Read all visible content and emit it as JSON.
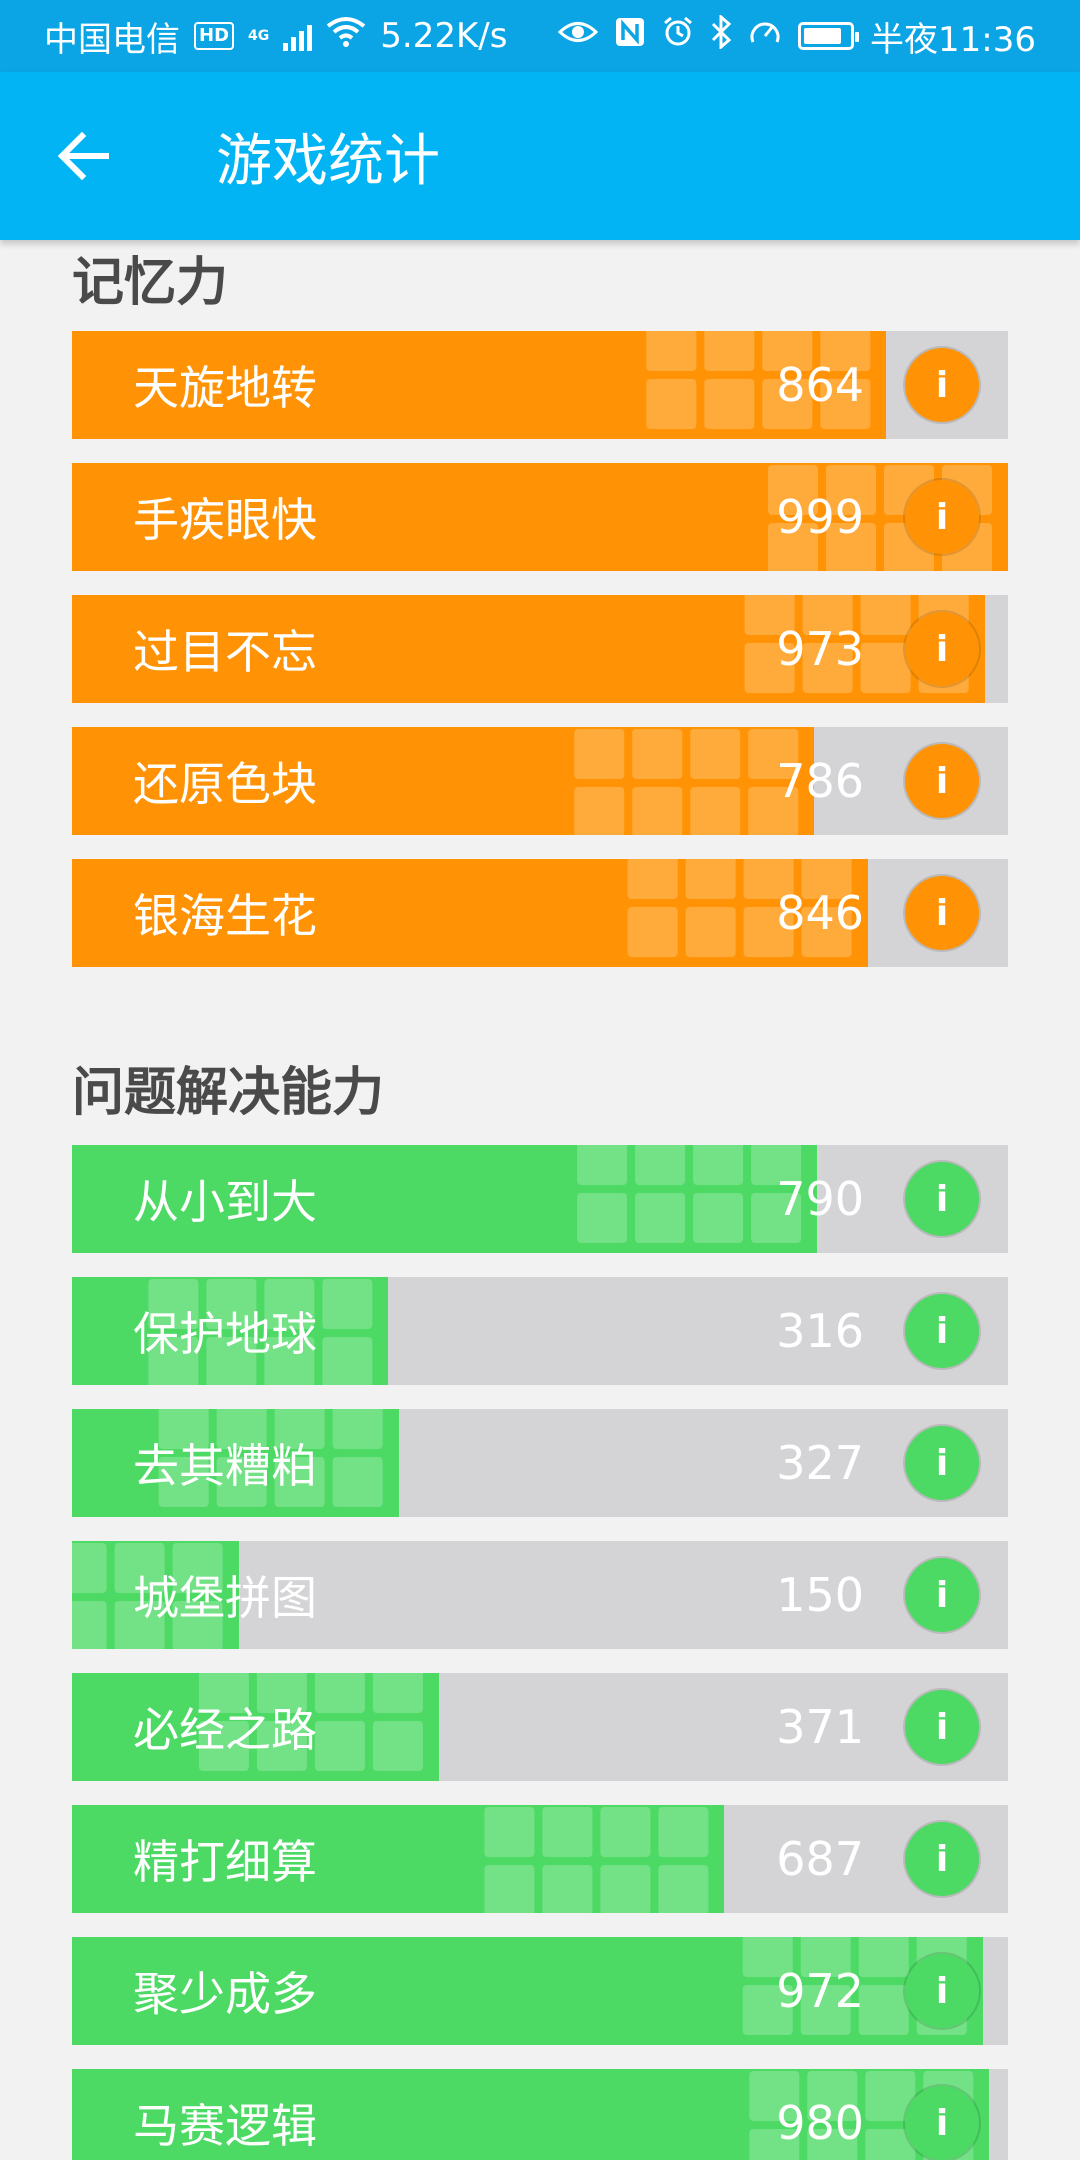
{
  "status_bar": {
    "carrier": "中国电信",
    "hd": "HD",
    "network": "4G",
    "speed": "5.22K/s",
    "time": "半夜11:36",
    "battery_level": 0.85
  },
  "app_bar": {
    "title": "游戏统计"
  },
  "sections": [
    {
      "title": "记忆力",
      "color": "#ff9305",
      "games": [
        {
          "name": "天旋地转",
          "score": "864",
          "fill": 0.87
        },
        {
          "name": "手疾眼快",
          "score": "999",
          "fill": 1.0
        },
        {
          "name": "过目不忘",
          "score": "973",
          "fill": 0.975
        },
        {
          "name": "还原色块",
          "score": "786",
          "fill": 0.793
        },
        {
          "name": "银海生花",
          "score": "846",
          "fill": 0.85
        }
      ]
    },
    {
      "title": "问题解决能力",
      "color": "#4cd964",
      "games": [
        {
          "name": "从小到大",
          "score": "790",
          "fill": 0.796
        },
        {
          "name": "保护地球",
          "score": "316",
          "fill": 0.338
        },
        {
          "name": "去其糟粕",
          "score": "327",
          "fill": 0.349
        },
        {
          "name": "城堡拼图",
          "score": "150",
          "fill": 0.178
        },
        {
          "name": "必经之路",
          "score": "371",
          "fill": 0.392
        },
        {
          "name": "精打细算",
          "score": "687",
          "fill": 0.697
        },
        {
          "name": "聚少成多",
          "score": "972",
          "fill": 0.973
        },
        {
          "name": "马赛逻辑",
          "score": "980",
          "fill": 0.98
        }
      ]
    }
  ]
}
